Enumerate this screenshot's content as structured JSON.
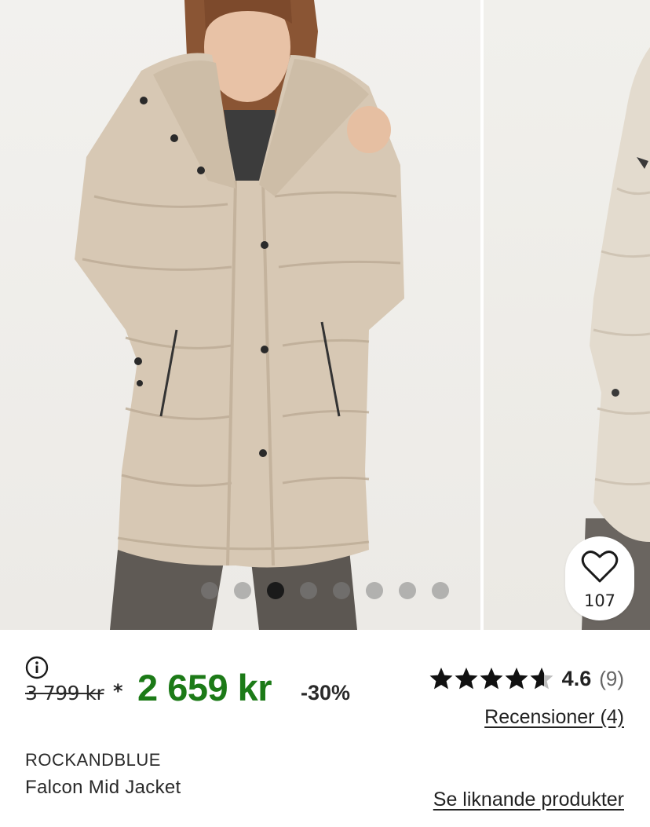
{
  "gallery": {
    "slides_count": 8,
    "active_slide_index": 2,
    "wishlist": {
      "icon": "heart-icon",
      "count": "107"
    }
  },
  "product": {
    "info_icon": "info-icon",
    "old_price": "3 799 kr",
    "asterisk": "*",
    "price": "2 659 kr",
    "discount": "-30%",
    "price_color": "#1c7a17",
    "rating": {
      "stars": 4.6,
      "value": "4.6",
      "count": "(9)"
    },
    "reviews_link": "Recensioner (4)",
    "brand": "ROCKANDBLUE",
    "name": "Falcon Mid Jacket",
    "similar_link": "Se liknande produkter"
  }
}
